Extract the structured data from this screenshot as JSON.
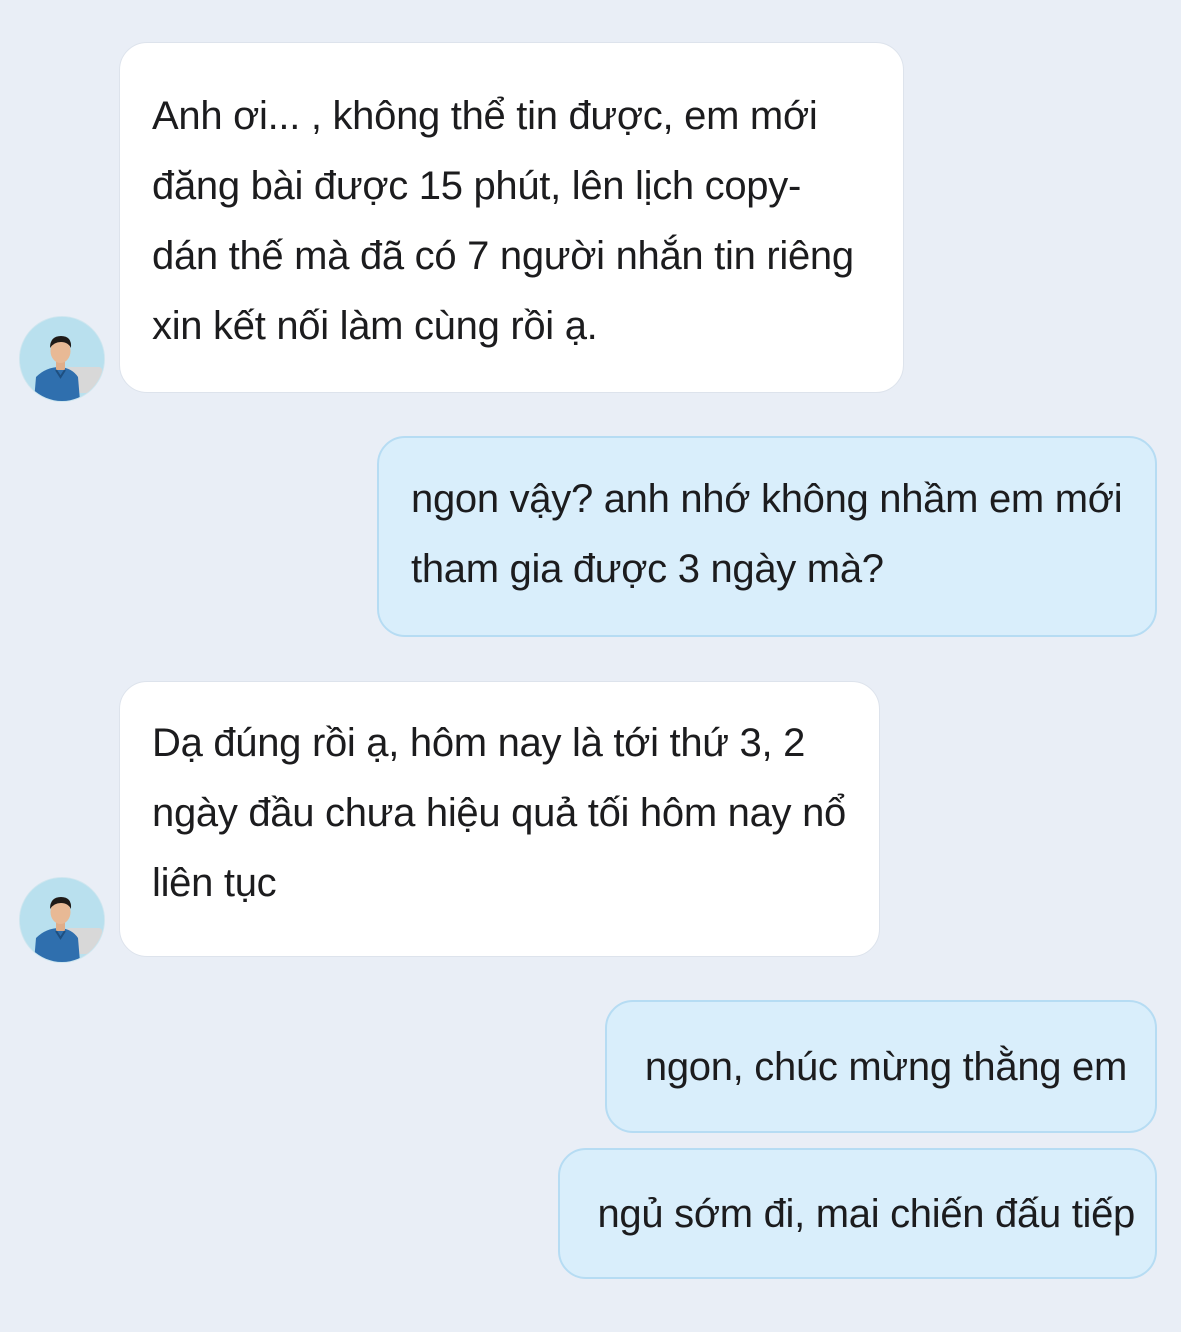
{
  "chat": {
    "messages": [
      {
        "sender": "contact",
        "lines": [
          "Anh ơi...   , không thể tin được, em mới",
          "đăng bài được 15 phút, lên lịch copy-",
          "dán thế mà đã có 7 người nhắn tin riêng",
          "xin kết nối làm cùng rồi ạ."
        ]
      },
      {
        "sender": "me",
        "lines": [
          "ngon vậy? anh nhớ không nhầm em mới",
          "tham gia được 3 ngày mà?"
        ]
      },
      {
        "sender": "contact",
        "lines": [
          "Dạ đúng rồi ạ, hôm nay là tới thứ 3, 2",
          "ngày đầu chưa hiệu quả tối hôm nay nổ",
          "liên tục"
        ]
      },
      {
        "sender": "me",
        "lines": [
          "ngon, chúc mừng thằng em"
        ]
      },
      {
        "sender": "me",
        "lines": [
          "ngủ sớm đi, mai chiến đấu tiếp"
        ]
      }
    ]
  },
  "icons": {
    "avatar": "contact-avatar-photo"
  },
  "colors": {
    "background": "#e9eef6",
    "incoming_bubble": "#ffffff",
    "outgoing_bubble": "#d9eefb",
    "outgoing_border": "#b6dcf3"
  }
}
